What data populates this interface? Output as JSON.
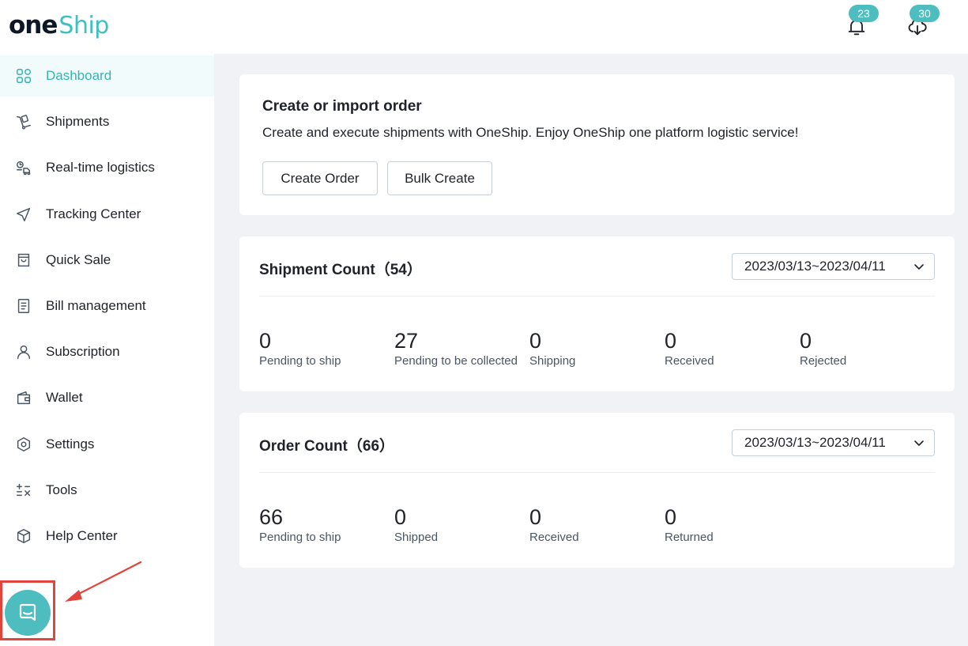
{
  "brand": {
    "one": "ONE",
    "ship": "Ship"
  },
  "header": {
    "notifications": {
      "count": "23",
      "icon": "bell-icon"
    },
    "downloads": {
      "count": "30",
      "icon": "download-icon"
    }
  },
  "sidebar": {
    "items": [
      {
        "label": "Dashboard",
        "icon": "dashboard-icon",
        "active": true
      },
      {
        "label": "Shipments",
        "icon": "shipments-icon"
      },
      {
        "label": "Real-time logistics",
        "icon": "logistics-icon"
      },
      {
        "label": "Tracking Center",
        "icon": "navigation-icon"
      },
      {
        "label": "Quick Sale",
        "icon": "shopping-bag-icon"
      },
      {
        "label": "Bill management",
        "icon": "bill-icon"
      },
      {
        "label": "Subscription",
        "icon": "user-icon"
      },
      {
        "label": "Wallet",
        "icon": "wallet-icon"
      },
      {
        "label": "Settings",
        "icon": "hexagon-settings-icon"
      },
      {
        "label": "Tools",
        "icon": "calculator-icon"
      },
      {
        "label": "Help Center",
        "icon": "box-icon"
      }
    ]
  },
  "create_card": {
    "title": "Create or import order",
    "description": "Create and execute shipments with OneShip. Enjoy OneShip one platform logistic service!",
    "create_button": "Create Order",
    "bulk_button": "Bulk Create"
  },
  "shipment_card": {
    "title": "Shipment Count（54）",
    "date_range": "2023/03/13~2023/04/11",
    "stats": [
      {
        "value": "0",
        "label": "Pending to ship"
      },
      {
        "value": "27",
        "label": "Pending to be collected"
      },
      {
        "value": "0",
        "label": "Shipping"
      },
      {
        "value": "0",
        "label": "Received"
      },
      {
        "value": "0",
        "label": "Rejected"
      }
    ]
  },
  "order_card": {
    "title": "Order Count（66）",
    "date_range": "2023/03/13~2023/04/11",
    "stats": [
      {
        "value": "66",
        "label": "Pending to ship"
      },
      {
        "value": "0",
        "label": "Shipped"
      },
      {
        "value": "0",
        "label": "Received"
      },
      {
        "value": "0",
        "label": "Returned"
      }
    ]
  },
  "colors": {
    "accent": "#36b3b6",
    "badge": "#4dbdc0",
    "highlight_box": "#e2433a",
    "page_bg": "#f0f2f5"
  },
  "chat": {
    "icon": "chat-icon"
  }
}
